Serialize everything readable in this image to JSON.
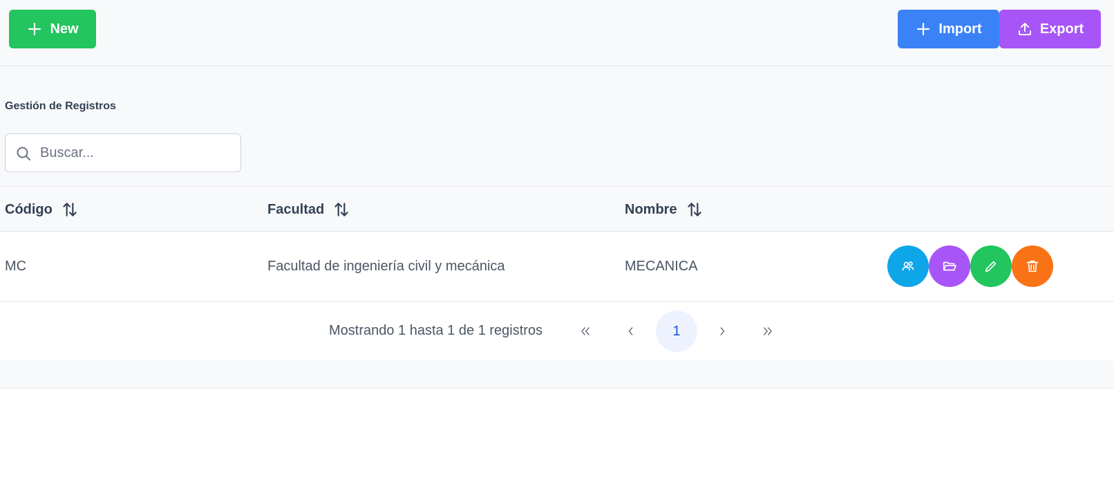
{
  "toolbar": {
    "new_label": "New",
    "import_label": "Import",
    "export_label": "Export"
  },
  "section": {
    "title": "Gestión de Registros"
  },
  "search": {
    "placeholder": "Buscar...",
    "value": ""
  },
  "table": {
    "columns": [
      "Código",
      "Facultad",
      "Nombre"
    ],
    "rows": [
      {
        "codigo": "MC",
        "facultad": "Facultad de ingeniería civil y mecánica",
        "nombre": "MECANICA"
      }
    ]
  },
  "paginator": {
    "summary": "Mostrando 1 hasta 1 de 1 registros",
    "current_page": "1"
  },
  "colors": {
    "new": "#22c55e",
    "import": "#3b82f6",
    "export": "#a855f7",
    "users_action": "#0ea5e9",
    "folder_action": "#a855f7",
    "edit_action": "#22c55e",
    "delete_action": "#f97316"
  },
  "icons": {
    "toolbar": [
      "plus-icon",
      "plus-icon",
      "upload-icon"
    ],
    "row_actions": [
      "users-icon",
      "folder-open-icon",
      "pencil-icon",
      "trash-icon"
    ],
    "sort": "sort-icon"
  }
}
